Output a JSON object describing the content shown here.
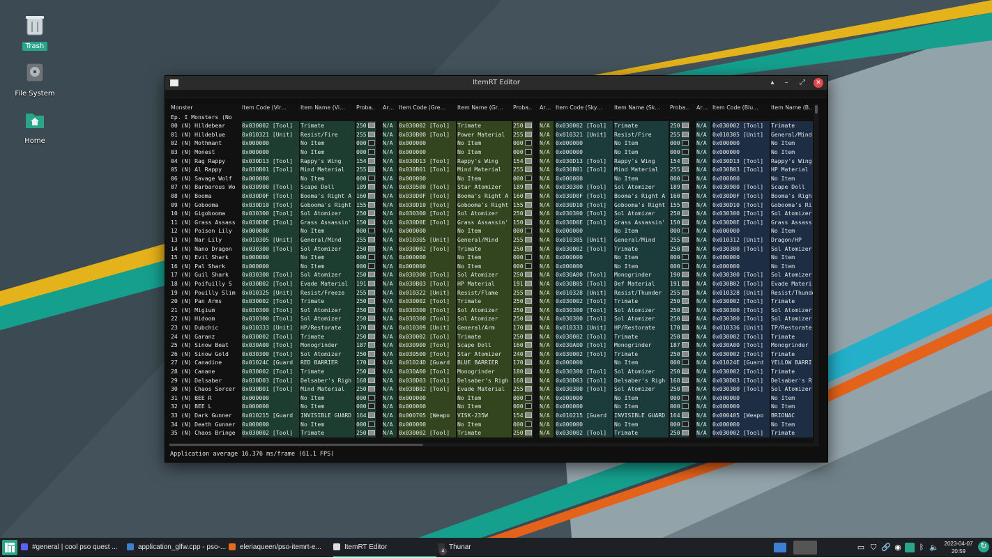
{
  "desktop": {
    "icons": [
      {
        "label": "Trash",
        "icon": "trash-icon"
      },
      {
        "label": "File System",
        "icon": "drive-icon"
      },
      {
        "label": "Home",
        "icon": "home-folder-icon"
      }
    ]
  },
  "window": {
    "title": "ItemRT Editor",
    "buttons": {
      "up": "▴",
      "minimize": "–",
      "maximize": "⤢",
      "close": "✕"
    },
    "columns": [
      "Monster",
      "Item Code (Vir…",
      "Item Name (Vi…",
      "Proba…",
      "Ar…",
      "Item Code (Gre…",
      "Item Name (Gr…",
      "Proba…",
      "Ar…",
      "Item Code (Sky…",
      "Item Name (Sk…",
      "Proba…",
      "Ar…",
      "Item Code (Blu…",
      "Item Name (B…"
    ],
    "section_label": "Ep. I Monsters (No",
    "rows": [
      [
        "00 (N) Hildebear",
        "0x030002 [Tool]",
        "Trimate",
        "250",
        "N/A",
        "0x030002 [Tool]",
        "Trimate",
        "250",
        "N/A",
        "0x030002 [Tool]",
        "Trimate",
        "250",
        "N/A",
        "0x030002 [Tool]",
        "Trimate"
      ],
      [
        "01 (N) Hildeblue",
        "0x010321 [Unit]",
        "Resist/Fire",
        "255",
        "N/A",
        "0x030B00 [Tool]",
        "Power Material",
        "255",
        "N/A",
        "0x010321 [Unit]",
        "Resist/Fire",
        "255",
        "N/A",
        "0x010305 [Unit]",
        "General/Mind"
      ],
      [
        "02 (N) Mothmant",
        "0x000000",
        "No Item",
        "000",
        "N/A",
        "0x000000",
        "No Item",
        "000",
        "N/A",
        "0x000000",
        "No Item",
        "000",
        "N/A",
        "0x000000",
        "No Item"
      ],
      [
        "03 (N) Monest",
        "0x000000",
        "No Item",
        "000",
        "N/A",
        "0x000000",
        "No Item",
        "000",
        "N/A",
        "0x000000",
        "No Item",
        "000",
        "N/A",
        "0x000000",
        "No Item"
      ],
      [
        "04 (N) Rag Rappy",
        "0x030D13 [Tool]",
        "Rappy's Wing",
        "154",
        "N/A",
        "0x030D13 [Tool]",
        "Rappy's Wing",
        "154",
        "N/A",
        "0x030D13 [Tool]",
        "Rappy's Wing",
        "154",
        "N/A",
        "0x030D13 [Tool]",
        "Rappy's Wing"
      ],
      [
        "05 (N) Al Rappy",
        "0x030B01 [Tool]",
        "Mind Material",
        "255",
        "N/A",
        "0x030B01 [Tool]",
        "Mind Material",
        "255",
        "N/A",
        "0x030B01 [Tool]",
        "Mind Material",
        "255",
        "N/A",
        "0x030B03 [Tool]",
        "HP Material"
      ],
      [
        "06 (N) Savage Wolf",
        "0x000000",
        "No Item",
        "000",
        "N/A",
        "0x000000",
        "No Item",
        "000",
        "N/A",
        "0x000000",
        "No Item",
        "000",
        "N/A",
        "0x000000",
        "No Item"
      ],
      [
        "07 (N) Barbarous Wo",
        "0x030900 [Tool]",
        "Scape Doll",
        "189",
        "N/A",
        "0x030500 [Tool]",
        "Star Atomizer",
        "189",
        "N/A",
        "0x030300 [Tool]",
        "Sol Atomizer",
        "189",
        "N/A",
        "0x030900 [Tool]",
        "Scape Doll"
      ],
      [
        "08 (N) Booma",
        "0x030D0F [Tool]",
        "Booma's Right A",
        "160",
        "N/A",
        "0x030D0F [Tool]",
        "Booma's Right A",
        "160",
        "N/A",
        "0x030D0F [Tool]",
        "Booma's Right A",
        "160",
        "N/A",
        "0x030D0F [Tool]",
        "Booma's Righ"
      ],
      [
        "09 (N) Gobooma",
        "0x030D10 [Tool]",
        "Gobooma's Right",
        "155",
        "N/A",
        "0x030D10 [Tool]",
        "Gobooma's Right",
        "155",
        "N/A",
        "0x030D10 [Tool]",
        "Gobooma's Right",
        "155",
        "N/A",
        "0x030D10 [Tool]",
        "Gobooma's Ri"
      ],
      [
        "10 (N) Gigobooma",
        "0x030300 [Tool]",
        "Sol Atomizer",
        "250",
        "N/A",
        "0x030300 [Tool]",
        "Sol Atomizer",
        "250",
        "N/A",
        "0x030300 [Tool]",
        "Sol Atomizer",
        "250",
        "N/A",
        "0x030300 [Tool]",
        "Sol Atomizer"
      ],
      [
        "11 (N) Grass Assass",
        "0x030D0E [Tool]",
        "Grass Assassin'",
        "150",
        "N/A",
        "0x030D0E [Tool]",
        "Grass Assassin'",
        "150",
        "N/A",
        "0x030D0E [Tool]",
        "Grass Assassin'",
        "150",
        "N/A",
        "0x030D0E [Tool]",
        "Grass Assass"
      ],
      [
        "12 (N) Poison Lily",
        "0x000000",
        "No Item",
        "000",
        "N/A",
        "0x000000",
        "No Item",
        "000",
        "N/A",
        "0x000000",
        "No Item",
        "000",
        "N/A",
        "0x000000",
        "No Item"
      ],
      [
        "13 (N) Nar Lily",
        "0x010305 [Unit]",
        "General/Mind",
        "255",
        "N/A",
        "0x010305 [Unit]",
        "General/Mind",
        "255",
        "N/A",
        "0x010305 [Unit]",
        "General/Mind",
        "255",
        "N/A",
        "0x010312 [Unit]",
        "Dragon/HP"
      ],
      [
        "14 (N) Nano Dragon",
        "0x030300 [Tool]",
        "Sol Atomizer",
        "250",
        "N/A",
        "0x030002 [Tool]",
        "Trimate",
        "250",
        "N/A",
        "0x030002 [Tool]",
        "Trimate",
        "250",
        "N/A",
        "0x030300 [Tool]",
        "Sol Atomizer"
      ],
      [
        "15 (N) Evil Shark",
        "0x000000",
        "No Item",
        "000",
        "N/A",
        "0x000000",
        "No Item",
        "000",
        "N/A",
        "0x000000",
        "No Item",
        "000",
        "N/A",
        "0x000000",
        "No Item"
      ],
      [
        "16 (N) Pal Shark",
        "0x000000",
        "No Item",
        "000",
        "N/A",
        "0x000000",
        "No Item",
        "000",
        "N/A",
        "0x000000",
        "No Item",
        "000",
        "N/A",
        "0x000000",
        "No Item"
      ],
      [
        "17 (N) Guil Shark",
        "0x030300 [Tool]",
        "Sol Atomizer",
        "250",
        "N/A",
        "0x030300 [Tool]",
        "Sol Atomizer",
        "250",
        "N/A",
        "0x030A00 [Tool]",
        "Monogrinder",
        "190",
        "N/A",
        "0x030300 [Tool]",
        "Sol Atomizer"
      ],
      [
        "18 (N) Poifuilly S",
        "0x030B02 [Tool]",
        "Evade Material",
        "191",
        "N/A",
        "0x030B03 [Tool]",
        "HP Material",
        "191",
        "N/A",
        "0x030B05 [Tool]",
        "Def Material",
        "191",
        "N/A",
        "0x030B02 [Tool]",
        "Evade Materi"
      ],
      [
        "19 (N) Pouilly Slim",
        "0x010325 [Unit]",
        "Resist/Freeze",
        "255",
        "N/A",
        "0x010322 [Unit]",
        "Resist/Flame",
        "255",
        "N/A",
        "0x010328 [Unit]",
        "Resist/Thunder",
        "255",
        "N/A",
        "0x010328 [Unit]",
        "Resist/Thunde"
      ],
      [
        "20 (N) Pan Arms",
        "0x030002 [Tool]",
        "Trimate",
        "250",
        "N/A",
        "0x030002 [Tool]",
        "Trimate",
        "250",
        "N/A",
        "0x030002 [Tool]",
        "Trimate",
        "250",
        "N/A",
        "0x030002 [Tool]",
        "Trimate"
      ],
      [
        "21 (N) Migium",
        "0x030300 [Tool]",
        "Sol Atomizer",
        "250",
        "N/A",
        "0x030300 [Tool]",
        "Sol Atomizer",
        "250",
        "N/A",
        "0x030300 [Tool]",
        "Sol Atomizer",
        "250",
        "N/A",
        "0x030300 [Tool]",
        "Sol Atomizer"
      ],
      [
        "22 (N) Hidoom",
        "0x030300 [Tool]",
        "Sol Atomizer",
        "250",
        "N/A",
        "0x030300 [Tool]",
        "Sol Atomizer",
        "250",
        "N/A",
        "0x030300 [Tool]",
        "Sol Atomizer",
        "250",
        "N/A",
        "0x030300 [Tool]",
        "Sol Atomizer"
      ],
      [
        "23 (N) Dubchic",
        "0x010333 [Unit]",
        "HP/Restorate",
        "170",
        "N/A",
        "0x010309 [Unit]",
        "General/Arm",
        "170",
        "N/A",
        "0x010333 [Unit]",
        "HP/Restorate",
        "170",
        "N/A",
        "0x010336 [Unit]",
        "TP/Restorate"
      ],
      [
        "24 (N) Garanz",
        "0x030002 [Tool]",
        "Trimate",
        "250",
        "N/A",
        "0x030002 [Tool]",
        "Trimate",
        "250",
        "N/A",
        "0x030002 [Tool]",
        "Trimate",
        "250",
        "N/A",
        "0x030002 [Tool]",
        "Trimate"
      ],
      [
        "25 (N) Sinow Beat",
        "0x030A00 [Tool]",
        "Monogrinder",
        "187",
        "N/A",
        "0x030900 [Tool]",
        "Scape Doll",
        "160",
        "N/A",
        "0x030A00 [Tool]",
        "Monogrinder",
        "187",
        "N/A",
        "0x030A00 [Tool]",
        "Monogrinder"
      ],
      [
        "26 (N) Sinow Gold",
        "0x030300 [Tool]",
        "Sol Atomizer",
        "250",
        "N/A",
        "0x030500 [Tool]",
        "Star Atomizer",
        "240",
        "N/A",
        "0x030002 [Tool]",
        "Trimate",
        "250",
        "N/A",
        "0x030002 [Tool]",
        "Trimate"
      ],
      [
        "27 (N) Canadine",
        "0x01024C [Guard",
        "RED BARRIER",
        "170",
        "N/A",
        "0x01024D [Guard",
        "BLUE BARRIER",
        "170",
        "N/A",
        "0x000000",
        "No Item",
        "000",
        "N/A",
        "0x01024E [Guard",
        "YELLOW BARRI"
      ],
      [
        "28 (N) Canane",
        "0x030002 [Tool]",
        "Trimate",
        "250",
        "N/A",
        "0x030A00 [Tool]",
        "Monogrinder",
        "180",
        "N/A",
        "0x030300 [Tool]",
        "Sol Atomizer",
        "250",
        "N/A",
        "0x030002 [Tool]",
        "Trimate"
      ],
      [
        "29 (N) Delsaber",
        "0x030D03 [Tool]",
        "Delsaber's Righ",
        "168",
        "N/A",
        "0x030D03 [Tool]",
        "Delsaber's Righ",
        "168",
        "N/A",
        "0x030D03 [Tool]",
        "Delsaber's Righ",
        "168",
        "N/A",
        "0x030D03 [Tool]",
        "Delsaber's R"
      ],
      [
        "30 (N) Chaos Sorcer",
        "0x030B01 [Tool]",
        "Mind Material",
        "250",
        "N/A",
        "0x030B02 [Tool]",
        "Evade Material",
        "255",
        "N/A",
        "0x030300 [Tool]",
        "Sol Atomizer",
        "250",
        "N/A",
        "0x030300 [Tool]",
        "Sol Atomizer"
      ],
      [
        "31 (N) BEE R",
        "0x000000",
        "No Item",
        "000",
        "N/A",
        "0x000000",
        "No Item",
        "000",
        "N/A",
        "0x000000",
        "No Item",
        "000",
        "N/A",
        "0x000000",
        "No Item"
      ],
      [
        "32 (N) BEE L",
        "0x000000",
        "No Item",
        "000",
        "N/A",
        "0x000000",
        "No Item",
        "000",
        "N/A",
        "0x000000",
        "No Item",
        "000",
        "N/A",
        "0x000000",
        "No Item"
      ],
      [
        "33 (N) Dark Gunner",
        "0x010215 [Guard",
        "INVISIBLE GUARD",
        "164",
        "N/A",
        "0x000705 [Weapo",
        "VISK-235W",
        "154",
        "N/A",
        "0x010215 [Guard",
        "INVISIBLE GUARD",
        "164",
        "N/A",
        "0x000405 [Weapo",
        "BRIONAC"
      ],
      [
        "34 (N) Death Gunner",
        "0x000000",
        "No Item",
        "000",
        "N/A",
        "0x000000",
        "No Item",
        "000",
        "N/A",
        "0x000000",
        "No Item",
        "000",
        "N/A",
        "0x000000",
        "No Item"
      ],
      [
        "35 (N) Chaos Bringe",
        "0x030002 [Tool]",
        "Trimate",
        "250",
        "N/A",
        "0x030002 [Tool]",
        "Trimate",
        "250",
        "N/A",
        "0x030002 [Tool]",
        "Trimate",
        "250",
        "N/A",
        "0x030002 [Tool]",
        "Trimate"
      ]
    ],
    "status": "Application average 16.376 ms/frame (61.1 FPS)"
  },
  "taskbar": {
    "tasks": [
      {
        "label": "#general | cool pso quest ...",
        "icon": "discord-icon",
        "color": "#5865f2"
      },
      {
        "label": "application_glfw.cpp - pso-...",
        "icon": "editor-icon",
        "color": "#3f7fd1"
      },
      {
        "label": "eleriaqueen/pso-itemrt-e...",
        "icon": "firefox-icon",
        "color": "#e66b1f"
      },
      {
        "label": "ItemRT Editor",
        "icon": "window-icon",
        "color": "#dddddd"
      },
      {
        "label": "Thunar",
        "icon": "folder-icon",
        "color": "#333333",
        "badge": "4"
      }
    ],
    "clock": {
      "date": "2023-04-07",
      "time": "20:59"
    }
  },
  "colors": {
    "wall_base": "#3a4a52",
    "accent_teal": "#15a08e",
    "accent_yellow": "#e4b21a",
    "accent_orange": "#e5621a",
    "accent_cyan": "#23b0c8",
    "col_viridia": "#1d3d30",
    "col_greenill": "#32451f",
    "col_skyly": "#1c3c3c",
    "col_bluefull": "#1c2d44"
  }
}
